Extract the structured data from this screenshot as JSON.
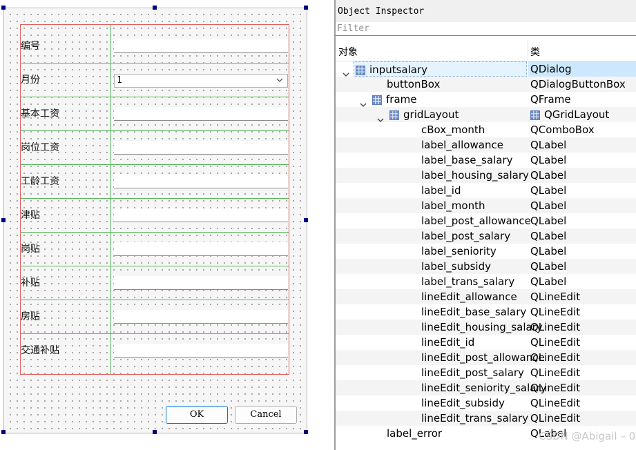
{
  "form": {
    "rows": [
      {
        "label": "编号"
      },
      {
        "label": "月份",
        "combo_value": "1"
      },
      {
        "label": "基本工资"
      },
      {
        "label": "岗位工资"
      },
      {
        "label": "工龄工资"
      },
      {
        "label": "津贴"
      },
      {
        "label": "岗贴"
      },
      {
        "label": "补贴"
      },
      {
        "label": "房贴"
      },
      {
        "label": "交通补贴"
      }
    ],
    "ok_label": "OK",
    "cancel_label": "Cancel"
  },
  "inspector": {
    "title": "Object Inspector",
    "filter_placeholder": "Filter",
    "col_object": "对象",
    "col_class": "类",
    "tree": [
      {
        "name": "inputsalary",
        "class": "QDialog",
        "icon": "layout-grid-icon",
        "expanded": true
      },
      {
        "name": "buttonBox",
        "class": "QDialogButtonBox"
      },
      {
        "name": "frame",
        "class": "QFrame",
        "icon": "layout-grid-icon",
        "expanded": true
      },
      {
        "name": "gridLayout",
        "class": "QGridLayout",
        "icon": "layout-grid-icon",
        "expanded": true
      },
      {
        "name": "cBox_month",
        "class": "QComboBox"
      },
      {
        "name": "label_allowance",
        "class": "QLabel"
      },
      {
        "name": "label_base_salary",
        "class": "QLabel"
      },
      {
        "name": "label_housing_salary",
        "class": "QLabel"
      },
      {
        "name": "label_id",
        "class": "QLabel"
      },
      {
        "name": "label_month",
        "class": "QLabel"
      },
      {
        "name": "label_post_allowance",
        "class": "QLabel"
      },
      {
        "name": "label_post_salary",
        "class": "QLabel"
      },
      {
        "name": "label_seniority",
        "class": "QLabel"
      },
      {
        "name": "label_subsidy",
        "class": "QLabel"
      },
      {
        "name": "label_trans_salary",
        "class": "QLabel"
      },
      {
        "name": "lineEdit_allowance",
        "class": "QLineEdit"
      },
      {
        "name": "lineEdit_base_salary",
        "class": "QLineEdit"
      },
      {
        "name": "lineEdit_housing_salary",
        "class": "QLineEdit"
      },
      {
        "name": "lineEdit_id",
        "class": "QLineEdit"
      },
      {
        "name": "lineEdit_post_allowance",
        "class": "QLineEdit"
      },
      {
        "name": "lineEdit_post_salary",
        "class": "QLineEdit"
      },
      {
        "name": "lineEdit_seniority_salary",
        "class": "QLineEdit"
      },
      {
        "name": "lineEdit_subsidy",
        "class": "QLineEdit"
      },
      {
        "name": "lineEdit_trans_salary",
        "class": "QLineEdit"
      },
      {
        "name": "label_error",
        "class": "QLabel"
      }
    ]
  },
  "watermark": "CSDN @Abigail – 0",
  "colors": {
    "selection": "#cce8ff",
    "frame_border": "#e06060",
    "grid_line": "#57b35a",
    "handle": "#000080",
    "ok_focus": "#0078d7"
  }
}
